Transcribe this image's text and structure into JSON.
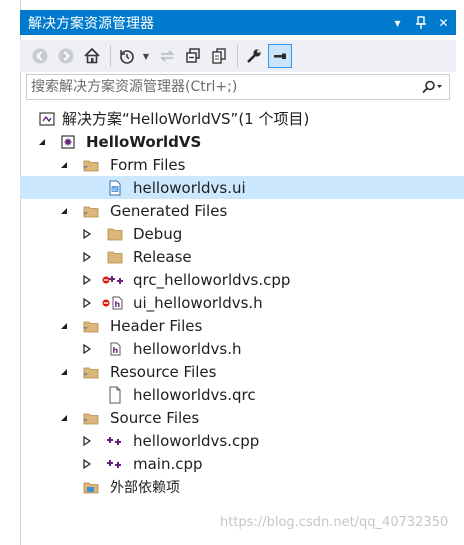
{
  "window": {
    "title": "解决方案资源管理器",
    "buttons": {
      "dropdown": "▾",
      "pin": "ᵻ",
      "close": "✕"
    }
  },
  "toolbar": {
    "icons": [
      "back-icon",
      "forward-icon",
      "home-icon",
      "history-icon",
      "sync-icon",
      "collapse-all-icon",
      "copy-icon",
      "properties-icon",
      "preview-icon"
    ]
  },
  "search": {
    "placeholder": "搜索解决方案资源管理器(Ctrl+;)"
  },
  "tree": {
    "solution": "解决方案“HelloWorldVS”(1 个项目)",
    "project": "HelloWorldVS",
    "items": [
      {
        "label": "Form Files"
      },
      {
        "label": "helloworldvs.ui"
      },
      {
        "label": "Generated Files"
      },
      {
        "label": "Debug"
      },
      {
        "label": "Release"
      },
      {
        "label": "qrc_helloworldvs.cpp"
      },
      {
        "label": "ui_helloworldvs.h"
      },
      {
        "label": "Header Files"
      },
      {
        "label": "helloworldvs.h"
      },
      {
        "label": "Resource Files"
      },
      {
        "label": "helloworldvs.qrc"
      },
      {
        "label": "Source Files"
      },
      {
        "label": "helloworldvs.cpp"
      },
      {
        "label": "main.cpp"
      },
      {
        "label": "外部依赖项"
      }
    ]
  },
  "watermark": "https://blog.csdn.net/qq_40732350",
  "colors": {
    "titlebar": "#007acc",
    "selection": "#cce8ff",
    "folder": "#dcb67a",
    "cpp": "#68217a"
  }
}
